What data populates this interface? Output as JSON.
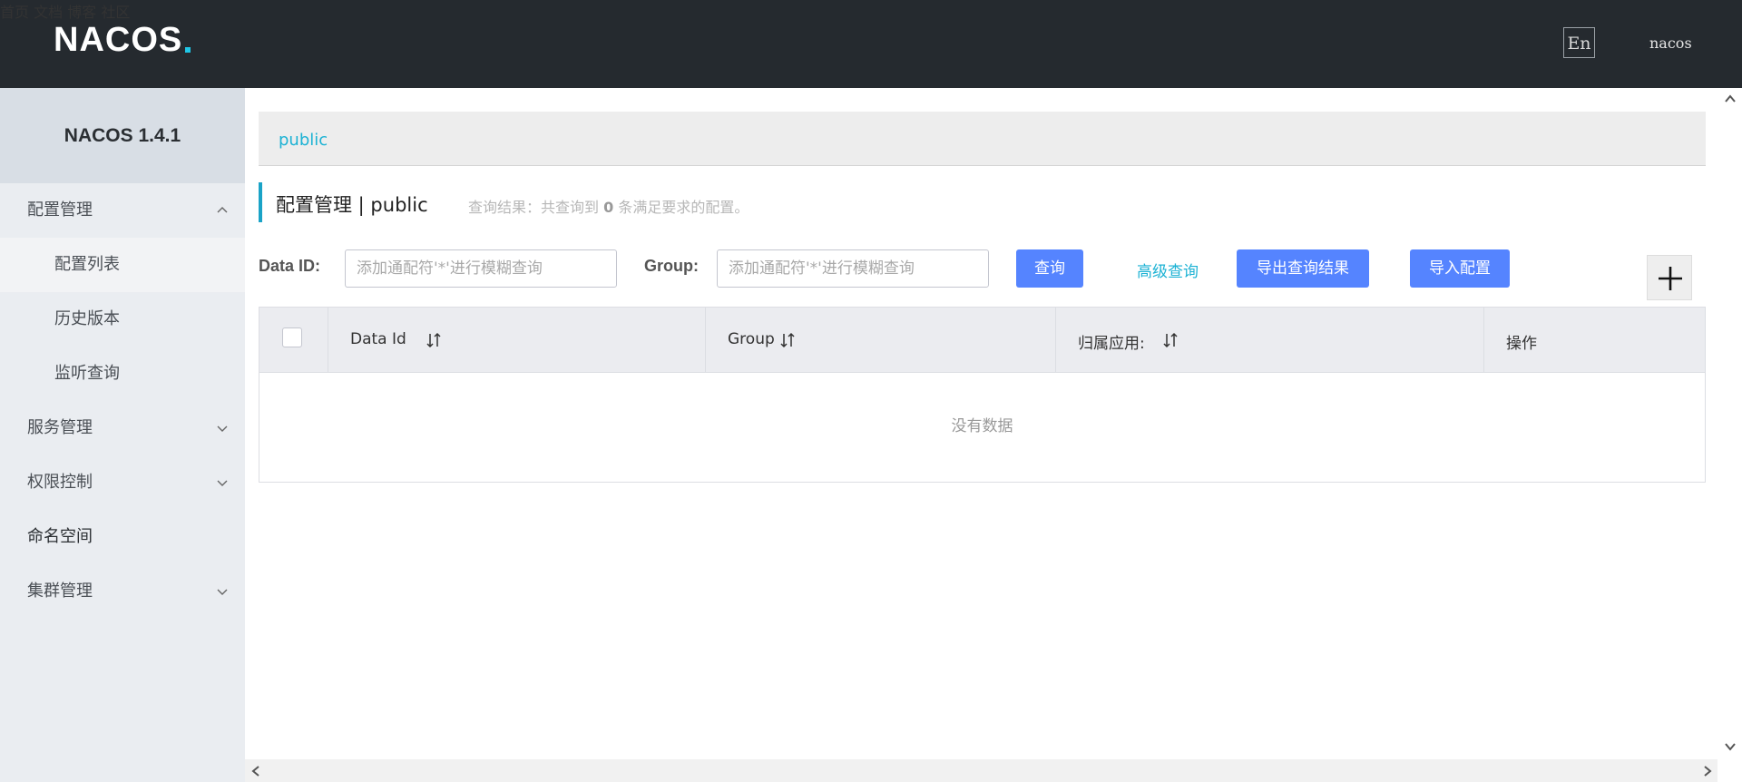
{
  "header": {
    "logo_text": "NACOS",
    "nav": [
      "首页",
      "文档",
      "博客",
      "社区"
    ],
    "lang_label": "En",
    "user": "nacos"
  },
  "sidebar": {
    "title": "NACOS 1.4.1",
    "items": [
      {
        "label": "配置管理",
        "expanded": true
      },
      {
        "label": "配置列表",
        "sub": true,
        "active": true
      },
      {
        "label": "历史版本",
        "sub": true
      },
      {
        "label": "监听查询",
        "sub": true
      },
      {
        "label": "服务管理",
        "expanded": false
      },
      {
        "label": "权限控制",
        "expanded": false
      },
      {
        "label": "命名空间"
      },
      {
        "label": "集群管理",
        "expanded": false
      }
    ]
  },
  "main": {
    "namespace_tab": "public",
    "title": "配置管理 | public",
    "result_prefix": "查询结果：共查询到",
    "result_count": "0",
    "result_suffix": "条满足要求的配置。",
    "search": {
      "data_id_label": "Data ID:",
      "data_id_placeholder": "添加通配符'*'进行模糊查询",
      "group_label": "Group:",
      "group_placeholder": "添加通配符'*'进行模糊查询",
      "query_button": "查询",
      "advanced_link": "高级查询",
      "export_button": "导出查询结果",
      "import_button": "导入配置"
    },
    "table": {
      "columns": [
        "Data Id",
        "Group",
        "归属应用:",
        "操作"
      ],
      "empty_text": "没有数据"
    }
  },
  "colors": {
    "header_bg": "#252a2f",
    "accent": "#1cb2d4",
    "primary_button": "#5584ff",
    "sidebar_bg": "#eaedf1"
  }
}
